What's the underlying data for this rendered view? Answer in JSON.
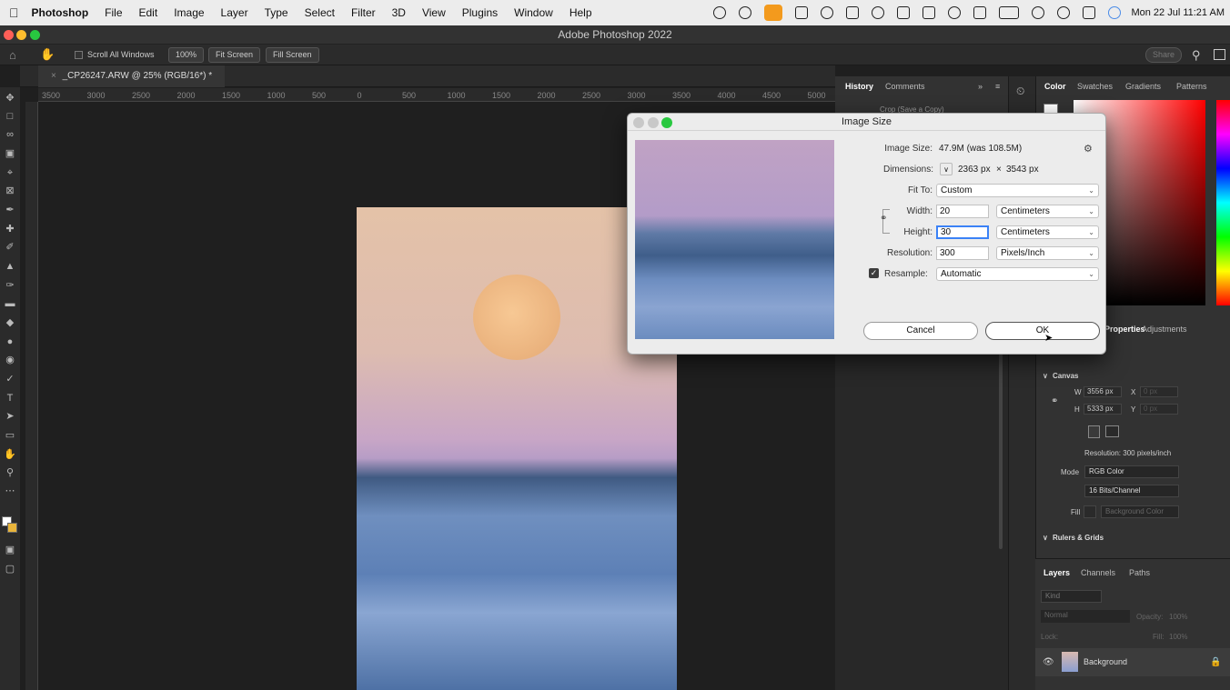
{
  "menubar": {
    "app_name": "Photoshop",
    "items": [
      "File",
      "Edit",
      "Image",
      "Layer",
      "Type",
      "Select",
      "Filter",
      "3D",
      "View",
      "Plugins",
      "Window",
      "Help"
    ],
    "clock": "Mon 22 Jul  11:21 AM"
  },
  "window": {
    "title": "Adobe Photoshop 2022"
  },
  "options": {
    "scroll_all": "Scroll All Windows",
    "zoom": "100%",
    "fit_screen": "Fit Screen",
    "fill_screen": "Fill Screen",
    "share": "Share"
  },
  "document": {
    "tab": "_CP26247.ARW @ 25% (RGB/16*) *"
  },
  "ruler": {
    "h_ticks": [
      "3500",
      "3000",
      "2500",
      "2000",
      "1500",
      "1000",
      "500",
      "0",
      "500",
      "1000",
      "1500",
      "2000",
      "2500",
      "3000",
      "3500",
      "4000",
      "4500",
      "5000"
    ]
  },
  "history_panel": {
    "tabs": [
      "History",
      "Comments"
    ],
    "item": "Crop (Save a Copy)"
  },
  "color_panel": {
    "tabs": [
      "Color",
      "Swatches",
      "Gradients",
      "Patterns"
    ]
  },
  "properties_panel": {
    "tabs": [
      "Properties",
      "Adjustments"
    ],
    "canvas_label": "Canvas",
    "w_label": "W",
    "w_value": "3556 px",
    "h_label": "H",
    "h_value": "5333 px",
    "x_label": "X",
    "x_value": "0 px",
    "y_label": "Y",
    "y_value": "0 px",
    "resolution": "Resolution: 300 pixels/inch",
    "mode_label": "Mode",
    "mode_value": "RGB Color",
    "bits_value": "16 Bits/Channel",
    "fill_label": "Fill",
    "fill_value": "Background Color",
    "rulers_grids": "Rulers & Grids"
  },
  "layers_panel": {
    "tabs": [
      "Layers",
      "Channels",
      "Paths"
    ],
    "kind": "Kind",
    "blend": "Normal",
    "opacity_label": "Opacity:",
    "opacity_value": "100%",
    "lock_label": "Lock:",
    "fill_label": "Fill:",
    "fill_value": "100%",
    "layer_name": "Background"
  },
  "dialog": {
    "title": "Image Size",
    "image_size_label": "Image Size:",
    "image_size_value": "47.9M (was 108.5M)",
    "dimensions_label": "Dimensions:",
    "dim_w": "2363 px",
    "dim_x": "×",
    "dim_h": "3543 px",
    "fit_label": "Fit To:",
    "fit_value": "Custom",
    "width_label": "Width:",
    "width_value": "20",
    "width_unit": "Centimeters",
    "height_label": "Height:",
    "height_value": "30",
    "height_unit": "Centimeters",
    "res_label": "Resolution:",
    "res_value": "300",
    "res_unit": "Pixels/Inch",
    "resample_label": "Resample:",
    "resample_value": "Automatic",
    "cancel": "Cancel",
    "ok": "OK"
  },
  "colors": {
    "accent": "#3b82f6",
    "mic": "#f39a1d"
  }
}
